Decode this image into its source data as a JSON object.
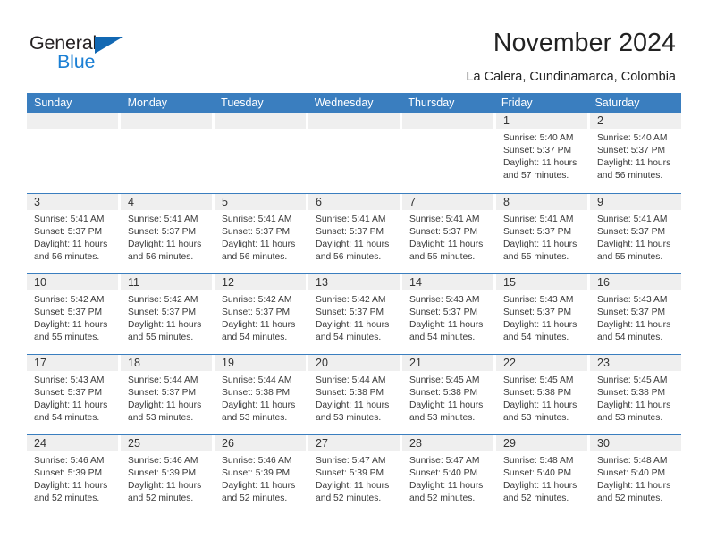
{
  "brand": {
    "word_one": "General",
    "word_two": "Blue",
    "triangle_icon": "triangle-icon",
    "accent_color": "#1a7fd4"
  },
  "header": {
    "title": "November 2024",
    "subtitle": "La Calera, Cundinamarca, Colombia",
    "header_color": "#3a7ebf"
  },
  "weekdays": [
    "Sunday",
    "Monday",
    "Tuesday",
    "Wednesday",
    "Thursday",
    "Friday",
    "Saturday"
  ],
  "weeks": [
    [
      {
        "day": "",
        "lines": []
      },
      {
        "day": "",
        "lines": []
      },
      {
        "day": "",
        "lines": []
      },
      {
        "day": "",
        "lines": []
      },
      {
        "day": "",
        "lines": []
      },
      {
        "day": "1",
        "lines": [
          "Sunrise: 5:40 AM",
          "Sunset: 5:37 PM",
          "Daylight: 11 hours",
          "and 57 minutes."
        ]
      },
      {
        "day": "2",
        "lines": [
          "Sunrise: 5:40 AM",
          "Sunset: 5:37 PM",
          "Daylight: 11 hours",
          "and 56 minutes."
        ]
      }
    ],
    [
      {
        "day": "3",
        "lines": [
          "Sunrise: 5:41 AM",
          "Sunset: 5:37 PM",
          "Daylight: 11 hours",
          "and 56 minutes."
        ]
      },
      {
        "day": "4",
        "lines": [
          "Sunrise: 5:41 AM",
          "Sunset: 5:37 PM",
          "Daylight: 11 hours",
          "and 56 minutes."
        ]
      },
      {
        "day": "5",
        "lines": [
          "Sunrise: 5:41 AM",
          "Sunset: 5:37 PM",
          "Daylight: 11 hours",
          "and 56 minutes."
        ]
      },
      {
        "day": "6",
        "lines": [
          "Sunrise: 5:41 AM",
          "Sunset: 5:37 PM",
          "Daylight: 11 hours",
          "and 56 minutes."
        ]
      },
      {
        "day": "7",
        "lines": [
          "Sunrise: 5:41 AM",
          "Sunset: 5:37 PM",
          "Daylight: 11 hours",
          "and 55 minutes."
        ]
      },
      {
        "day": "8",
        "lines": [
          "Sunrise: 5:41 AM",
          "Sunset: 5:37 PM",
          "Daylight: 11 hours",
          "and 55 minutes."
        ]
      },
      {
        "day": "9",
        "lines": [
          "Sunrise: 5:41 AM",
          "Sunset: 5:37 PM",
          "Daylight: 11 hours",
          "and 55 minutes."
        ]
      }
    ],
    [
      {
        "day": "10",
        "lines": [
          "Sunrise: 5:42 AM",
          "Sunset: 5:37 PM",
          "Daylight: 11 hours",
          "and 55 minutes."
        ]
      },
      {
        "day": "11",
        "lines": [
          "Sunrise: 5:42 AM",
          "Sunset: 5:37 PM",
          "Daylight: 11 hours",
          "and 55 minutes."
        ]
      },
      {
        "day": "12",
        "lines": [
          "Sunrise: 5:42 AM",
          "Sunset: 5:37 PM",
          "Daylight: 11 hours",
          "and 54 minutes."
        ]
      },
      {
        "day": "13",
        "lines": [
          "Sunrise: 5:42 AM",
          "Sunset: 5:37 PM",
          "Daylight: 11 hours",
          "and 54 minutes."
        ]
      },
      {
        "day": "14",
        "lines": [
          "Sunrise: 5:43 AM",
          "Sunset: 5:37 PM",
          "Daylight: 11 hours",
          "and 54 minutes."
        ]
      },
      {
        "day": "15",
        "lines": [
          "Sunrise: 5:43 AM",
          "Sunset: 5:37 PM",
          "Daylight: 11 hours",
          "and 54 minutes."
        ]
      },
      {
        "day": "16",
        "lines": [
          "Sunrise: 5:43 AM",
          "Sunset: 5:37 PM",
          "Daylight: 11 hours",
          "and 54 minutes."
        ]
      }
    ],
    [
      {
        "day": "17",
        "lines": [
          "Sunrise: 5:43 AM",
          "Sunset: 5:37 PM",
          "Daylight: 11 hours",
          "and 54 minutes."
        ]
      },
      {
        "day": "18",
        "lines": [
          "Sunrise: 5:44 AM",
          "Sunset: 5:37 PM",
          "Daylight: 11 hours",
          "and 53 minutes."
        ]
      },
      {
        "day": "19",
        "lines": [
          "Sunrise: 5:44 AM",
          "Sunset: 5:38 PM",
          "Daylight: 11 hours",
          "and 53 minutes."
        ]
      },
      {
        "day": "20",
        "lines": [
          "Sunrise: 5:44 AM",
          "Sunset: 5:38 PM",
          "Daylight: 11 hours",
          "and 53 minutes."
        ]
      },
      {
        "day": "21",
        "lines": [
          "Sunrise: 5:45 AM",
          "Sunset: 5:38 PM",
          "Daylight: 11 hours",
          "and 53 minutes."
        ]
      },
      {
        "day": "22",
        "lines": [
          "Sunrise: 5:45 AM",
          "Sunset: 5:38 PM",
          "Daylight: 11 hours",
          "and 53 minutes."
        ]
      },
      {
        "day": "23",
        "lines": [
          "Sunrise: 5:45 AM",
          "Sunset: 5:38 PM",
          "Daylight: 11 hours",
          "and 53 minutes."
        ]
      }
    ],
    [
      {
        "day": "24",
        "lines": [
          "Sunrise: 5:46 AM",
          "Sunset: 5:39 PM",
          "Daylight: 11 hours",
          "and 52 minutes."
        ]
      },
      {
        "day": "25",
        "lines": [
          "Sunrise: 5:46 AM",
          "Sunset: 5:39 PM",
          "Daylight: 11 hours",
          "and 52 minutes."
        ]
      },
      {
        "day": "26",
        "lines": [
          "Sunrise: 5:46 AM",
          "Sunset: 5:39 PM",
          "Daylight: 11 hours",
          "and 52 minutes."
        ]
      },
      {
        "day": "27",
        "lines": [
          "Sunrise: 5:47 AM",
          "Sunset: 5:39 PM",
          "Daylight: 11 hours",
          "and 52 minutes."
        ]
      },
      {
        "day": "28",
        "lines": [
          "Sunrise: 5:47 AM",
          "Sunset: 5:40 PM",
          "Daylight: 11 hours",
          "and 52 minutes."
        ]
      },
      {
        "day": "29",
        "lines": [
          "Sunrise: 5:48 AM",
          "Sunset: 5:40 PM",
          "Daylight: 11 hours",
          "and 52 minutes."
        ]
      },
      {
        "day": "30",
        "lines": [
          "Sunrise: 5:48 AM",
          "Sunset: 5:40 PM",
          "Daylight: 11 hours",
          "and 52 minutes."
        ]
      }
    ]
  ]
}
